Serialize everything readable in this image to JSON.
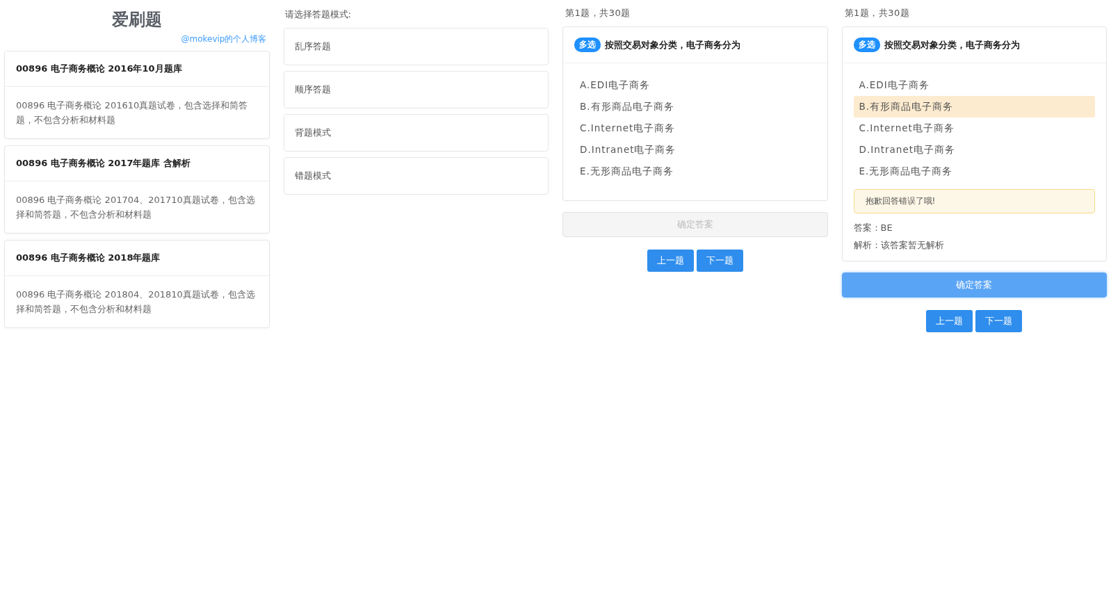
{
  "header": {
    "title": "爱刷题",
    "blog_link": "@mokevip的个人博客"
  },
  "banks": [
    {
      "title": "00896 电子商务概论 2016年10月题库",
      "description": "00896 电子商务概论 201610真题试卷，包含选择和简答题，不包含分析和材料题"
    },
    {
      "title": "00896 电子商务概论 2017年题库 含解析",
      "description": "00896 电子商务概论 201704、201710真题试卷，包含选择和简答题，不包含分析和材料题"
    },
    {
      "title": "00896 电子商务概论 2018年题库",
      "description": "00896 电子商务概论 201804、201810真题试卷，包含选择和简答题，不包含分析和材料题"
    }
  ],
  "mode_panel": {
    "prompt": "请选择答题模式:",
    "modes": [
      "乱序答题",
      "顺序答题",
      "背题模式",
      "错题模式"
    ]
  },
  "quizzes": [
    {
      "progress": "第1题，共30题",
      "tag": "多选",
      "question": "按照交易对象分类，电子商务分为",
      "options": [
        {
          "label": "A.EDI电子商务",
          "selected": false
        },
        {
          "label": "B.有形商品电子商务",
          "selected": false
        },
        {
          "label": "C.Internet电子商务",
          "selected": false
        },
        {
          "label": "D.Intranet电子商务",
          "selected": false
        },
        {
          "label": "E.无形商品电子商务",
          "selected": false
        }
      ],
      "submit": {
        "label": "确定答案",
        "disabled": true
      },
      "prev": "上一题",
      "next": "下一题"
    },
    {
      "progress": "第1题，共30题",
      "tag": "多选",
      "question": "按照交易对象分类，电子商务分为",
      "options": [
        {
          "label": "A.EDI电子商务",
          "selected": false
        },
        {
          "label": "B.有形商品电子商务",
          "selected": true
        },
        {
          "label": "C.Internet电子商务",
          "selected": false
        },
        {
          "label": "D.Intranet电子商务",
          "selected": false
        },
        {
          "label": "E.无形商品电子商务",
          "selected": false
        }
      ],
      "feedback": "抱歉回答错误了哦!",
      "answer": "答案：BE",
      "analysis": "解析：该答案暂无解析",
      "submit": {
        "label": "确定答案",
        "disabled": false
      },
      "prev": "上一题",
      "next": "下一题"
    }
  ]
}
